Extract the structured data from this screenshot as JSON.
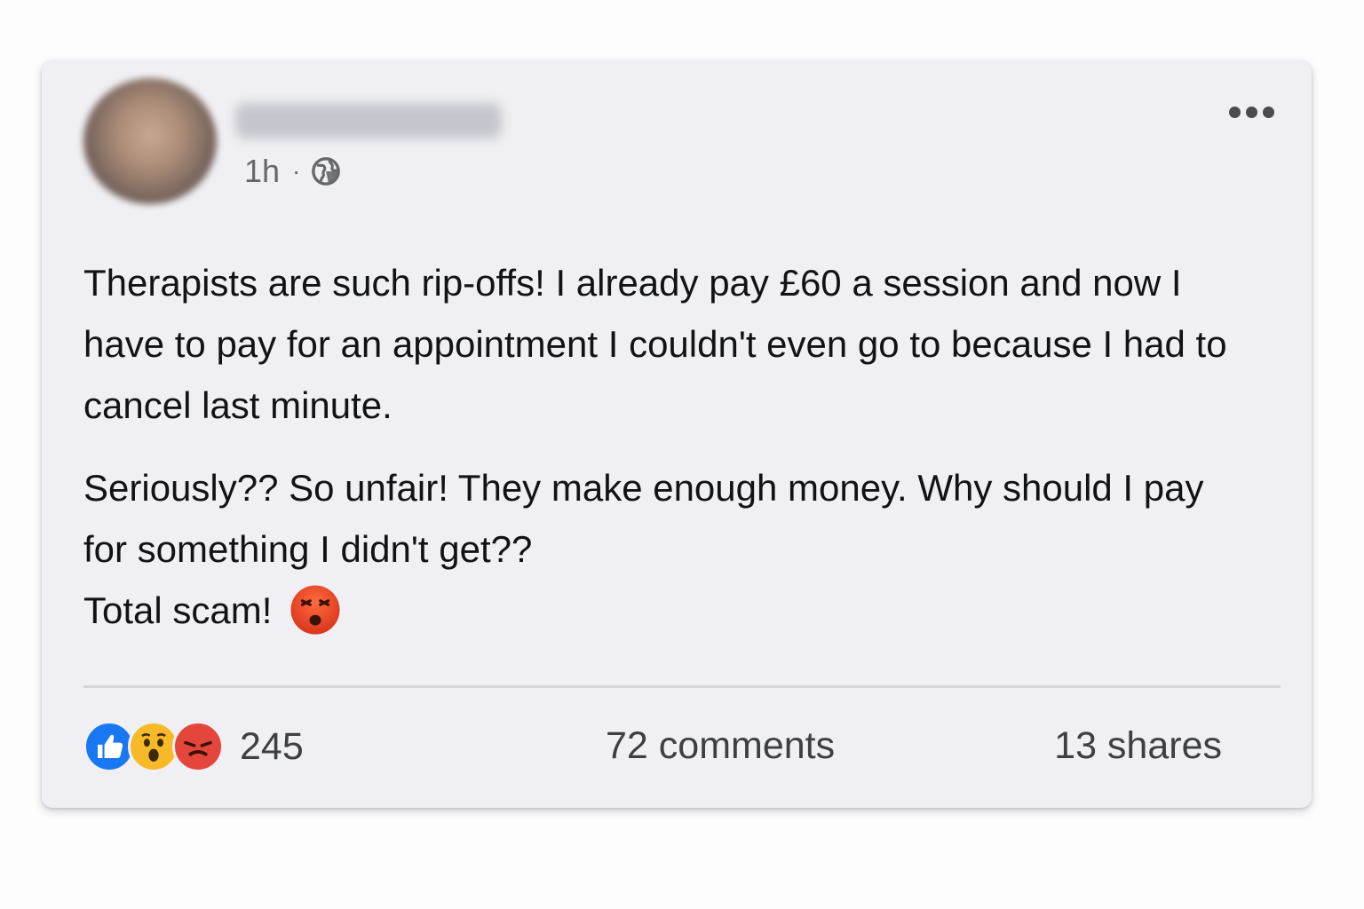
{
  "post": {
    "time": "1h",
    "separator": "·",
    "visibility_icon": "globe-icon",
    "more_icon": "more-options-icon",
    "paragraph_1": "Therapists are such rip-offs! I already pay £60 a session and now I have to pay for an appointment I couldn't even go to because I had to cancel last minute.",
    "paragraph_2_line_1": "Seriously?? So unfair! They make enough money. Why should I pay for something I didn't get??",
    "paragraph_2_line_2": "Total scam!",
    "inline_emoji": "angry-face-emoji"
  },
  "footer": {
    "reaction_icons": [
      "like-reaction-icon",
      "wow-reaction-icon",
      "angry-reaction-icon"
    ],
    "reaction_count": "245",
    "comments": "72 comments",
    "shares": "13 shares"
  },
  "colors": {
    "like_blue": "#1877f2",
    "wow_yellow": "#f7b928",
    "angry_red": "#e4463b",
    "text": "#121316",
    "meta_gray": "#65676b"
  }
}
